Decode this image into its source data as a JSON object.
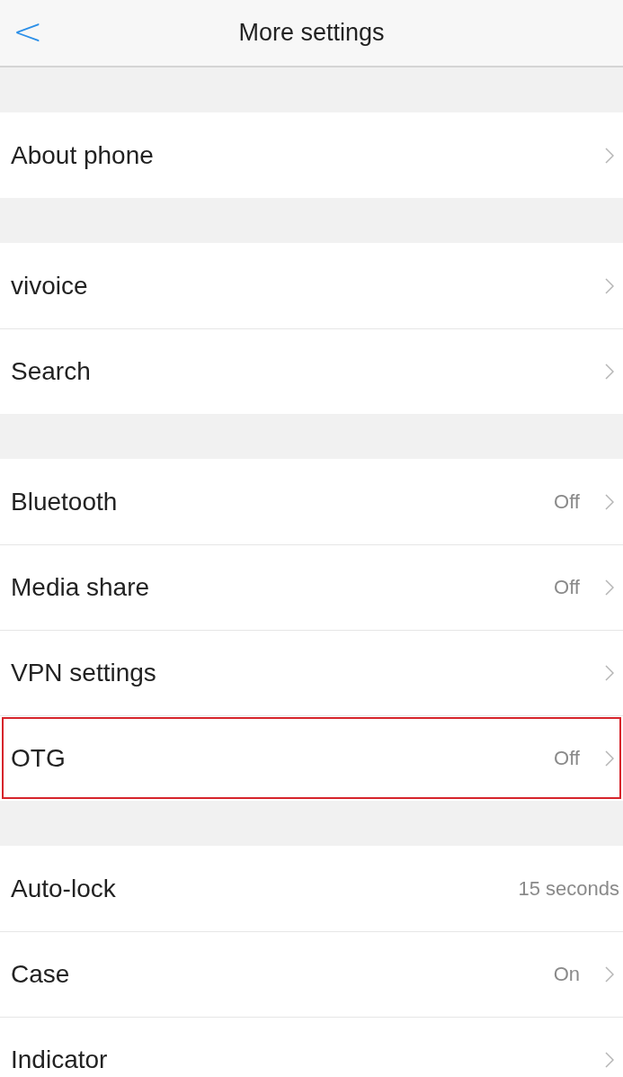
{
  "header": {
    "back": "<",
    "title": "More settings"
  },
  "groups": [
    {
      "items": [
        {
          "label": "About phone",
          "chevron": true,
          "highlighted": false
        }
      ]
    },
    {
      "items": [
        {
          "label": "vivoice",
          "chevron": true,
          "highlighted": false
        },
        {
          "label": "Search",
          "chevron": true,
          "highlighted": false
        }
      ]
    },
    {
      "items": [
        {
          "label": "Bluetooth",
          "value": "Off",
          "chevron": true,
          "highlighted": false
        },
        {
          "label": "Media share",
          "value": "Off",
          "chevron": true,
          "highlighted": false
        },
        {
          "label": "VPN settings",
          "chevron": true,
          "highlighted": false
        },
        {
          "label": "OTG",
          "value": "Off",
          "chevron": true,
          "highlighted": true
        }
      ]
    },
    {
      "items": [
        {
          "label": "Auto-lock",
          "value": "15 seconds",
          "chevron": false,
          "highlighted": false
        },
        {
          "label": "Case",
          "value": "On",
          "chevron": true,
          "highlighted": false
        },
        {
          "label": "Indicator",
          "chevron": true,
          "highlighted": false
        }
      ]
    }
  ]
}
